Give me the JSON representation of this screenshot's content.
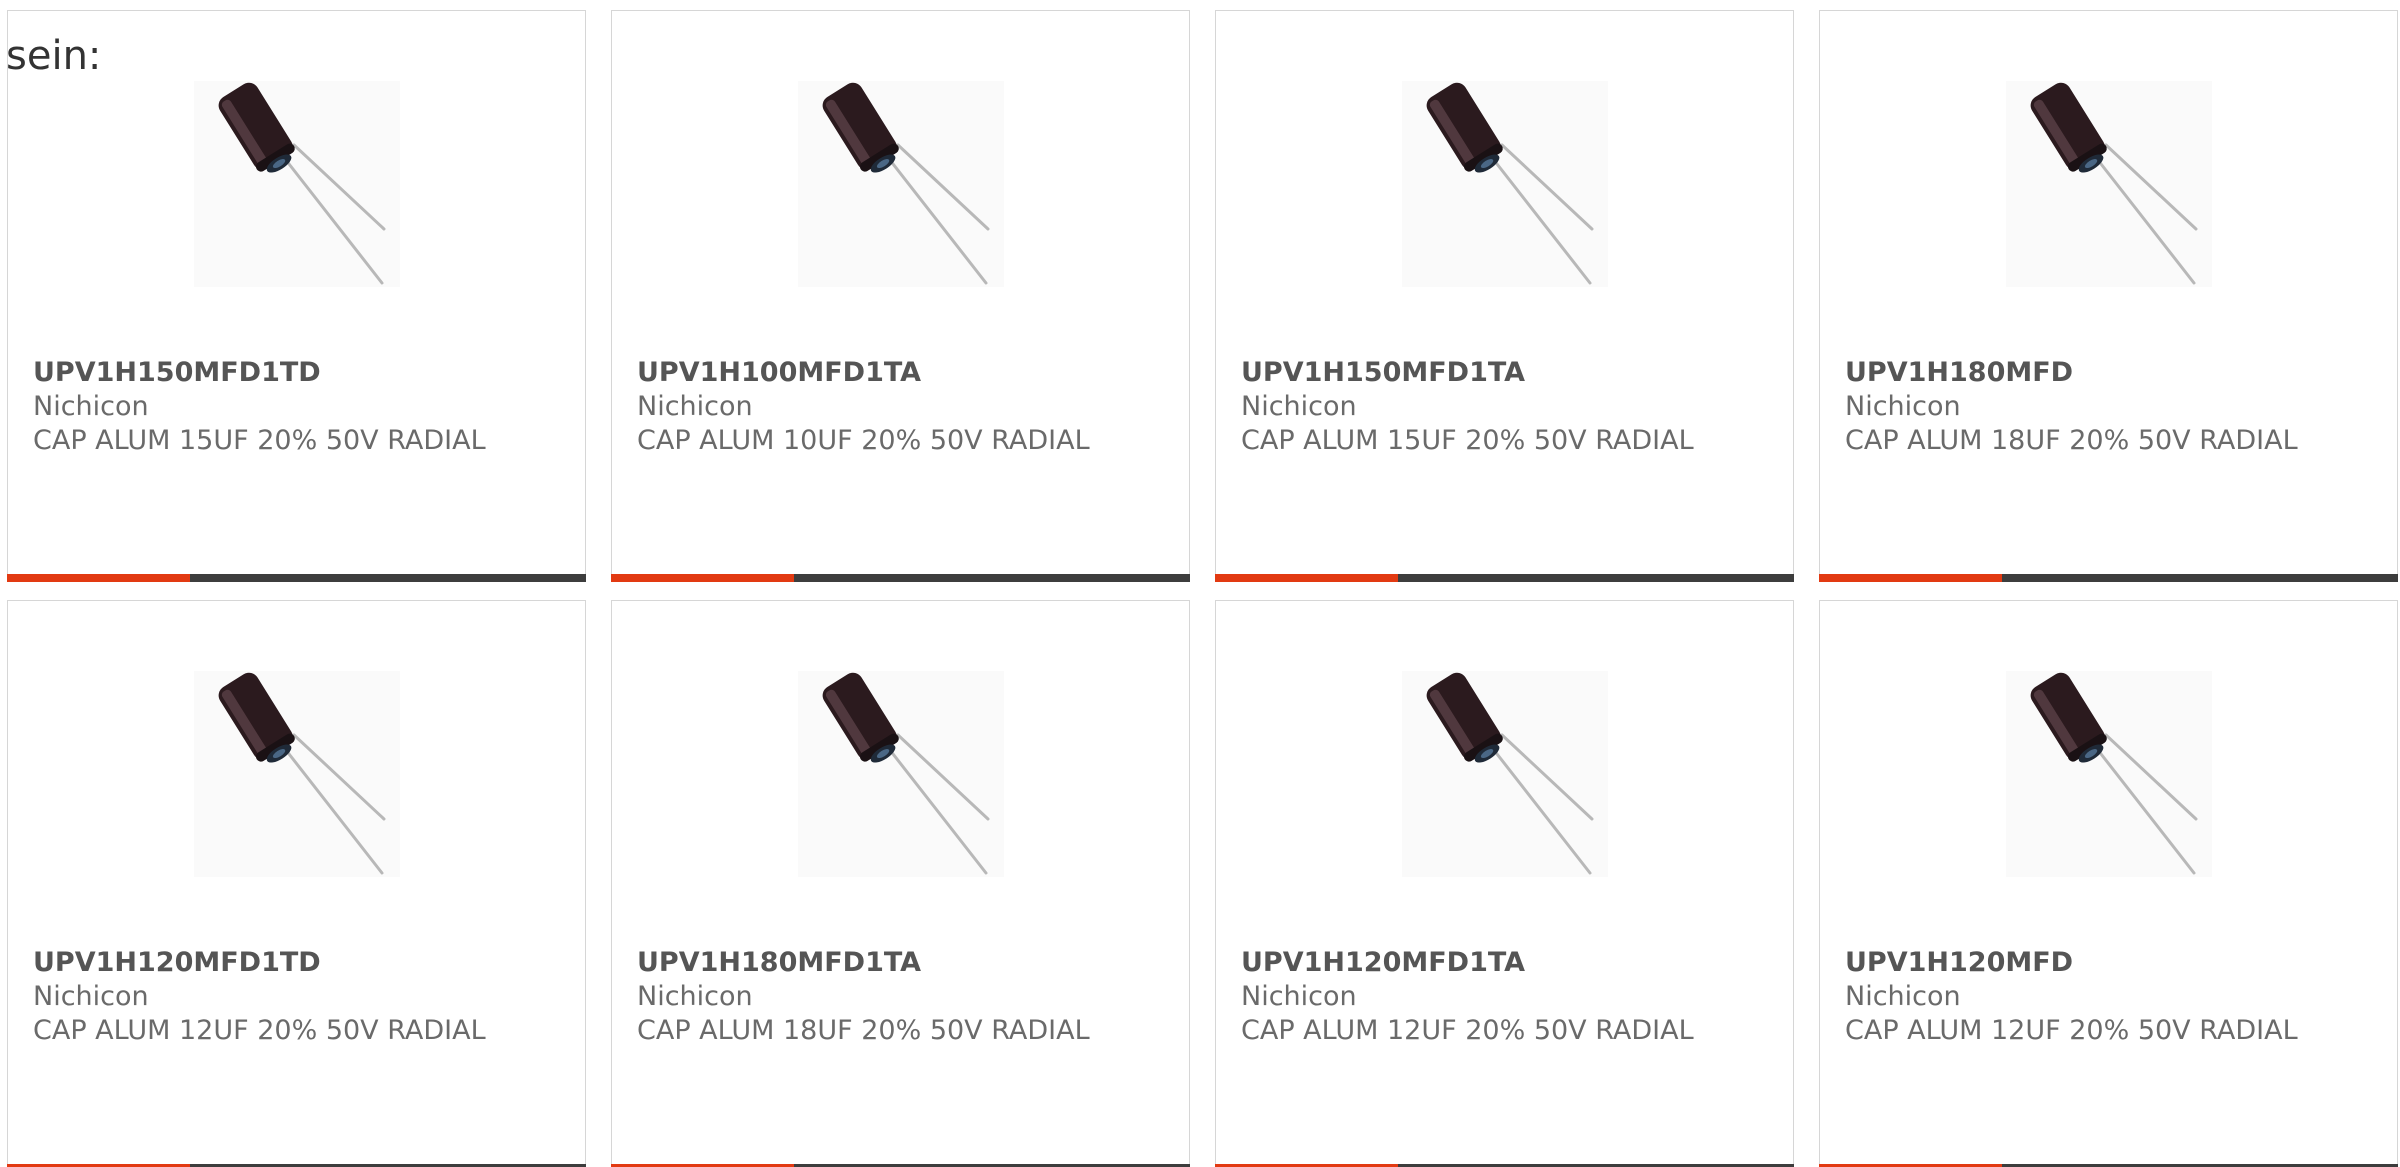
{
  "intro_text": "sein:",
  "colors": {
    "accent": "#e23a12",
    "bar": "#3d3d3d",
    "border": "#d6d6d6",
    "text": "#666666"
  },
  "products": [
    {
      "part_number": "UPV1H150MFD1TD",
      "manufacturer": "Nichicon",
      "description": "CAP ALUM 15UF 20% 50V RADIAL",
      "image": "radial-capacitor-icon"
    },
    {
      "part_number": "UPV1H100MFD1TA",
      "manufacturer": "Nichicon",
      "description": "CAP ALUM 10UF 20% 50V RADIAL",
      "image": "radial-capacitor-icon"
    },
    {
      "part_number": "UPV1H150MFD1TA",
      "manufacturer": "Nichicon",
      "description": "CAP ALUM 15UF 20% 50V RADIAL",
      "image": "radial-capacitor-icon"
    },
    {
      "part_number": "UPV1H180MFD",
      "manufacturer": "Nichicon",
      "description": "CAP ALUM 18UF 20% 50V RADIAL",
      "image": "radial-capacitor-icon"
    },
    {
      "part_number": "UPV1H120MFD1TD",
      "manufacturer": "Nichicon",
      "description": "CAP ALUM 12UF 20% 50V RADIAL",
      "image": "radial-capacitor-icon"
    },
    {
      "part_number": "UPV1H180MFD1TA",
      "manufacturer": "Nichicon",
      "description": "CAP ALUM 18UF 20% 50V RADIAL",
      "image": "radial-capacitor-icon"
    },
    {
      "part_number": "UPV1H120MFD1TA",
      "manufacturer": "Nichicon",
      "description": "CAP ALUM 12UF 20% 50V RADIAL",
      "image": "radial-capacitor-icon"
    },
    {
      "part_number": "UPV1H120MFD",
      "manufacturer": "Nichicon",
      "description": "CAP ALUM 12UF 20% 50V RADIAL",
      "image": "radial-capacitor-icon"
    }
  ]
}
